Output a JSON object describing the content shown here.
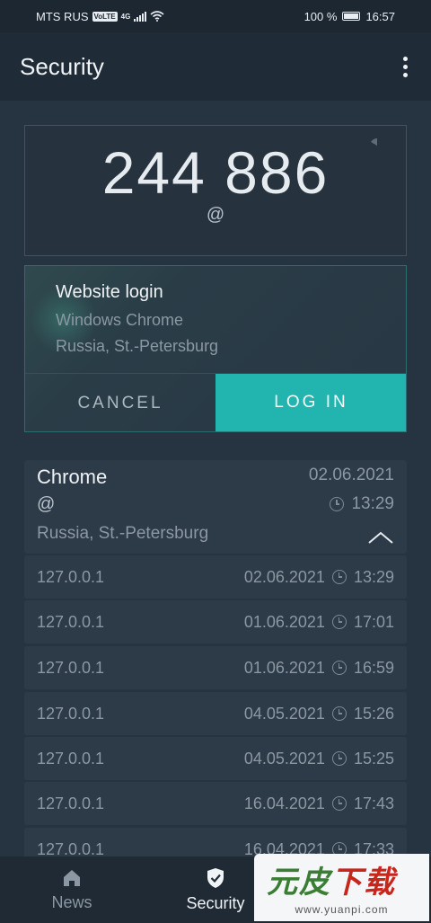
{
  "status_bar": {
    "carrier": "MTS RUS",
    "volte": "VoLTE",
    "network": "4G",
    "battery": "100 %",
    "time": "16:57"
  },
  "app_bar": {
    "title": "Security"
  },
  "code_card": {
    "code": "244 886",
    "account": "@"
  },
  "login_request": {
    "title": "Website login",
    "client": "Windows Chrome",
    "location": "Russia, St.-Petersburg",
    "cancel_label": "CANCEL",
    "login_label": "LOG IN",
    "accent_color": "#22b5b0"
  },
  "session": {
    "browser": "Chrome",
    "account": "@",
    "location": "Russia, St.-Petersburg",
    "date": "02.06.2021",
    "time": "13:29",
    "entries": [
      {
        "ip": "127.0.0.1",
        "date": "02.06.2021",
        "time": "13:29"
      },
      {
        "ip": "127.0.0.1",
        "date": "01.06.2021",
        "time": "17:01"
      },
      {
        "ip": "127.0.0.1",
        "date": "01.06.2021",
        "time": "16:59"
      },
      {
        "ip": "127.0.0.1",
        "date": "04.05.2021",
        "time": "15:26"
      },
      {
        "ip": "127.0.0.1",
        "date": "04.05.2021",
        "time": "15:25"
      },
      {
        "ip": "127.0.0.1",
        "date": "16.04.2021",
        "time": "17:43"
      },
      {
        "ip": "127.0.0.1",
        "date": "16.04.2021",
        "time": "17:33"
      }
    ]
  },
  "bottom_nav": {
    "items": [
      {
        "label": "News",
        "icon": "home-icon"
      },
      {
        "label": "Security",
        "icon": "shield-check-icon"
      }
    ]
  },
  "watermark": {
    "text_green": "元皮",
    "text_red": "下载",
    "url": "www.yuanpi.com"
  }
}
